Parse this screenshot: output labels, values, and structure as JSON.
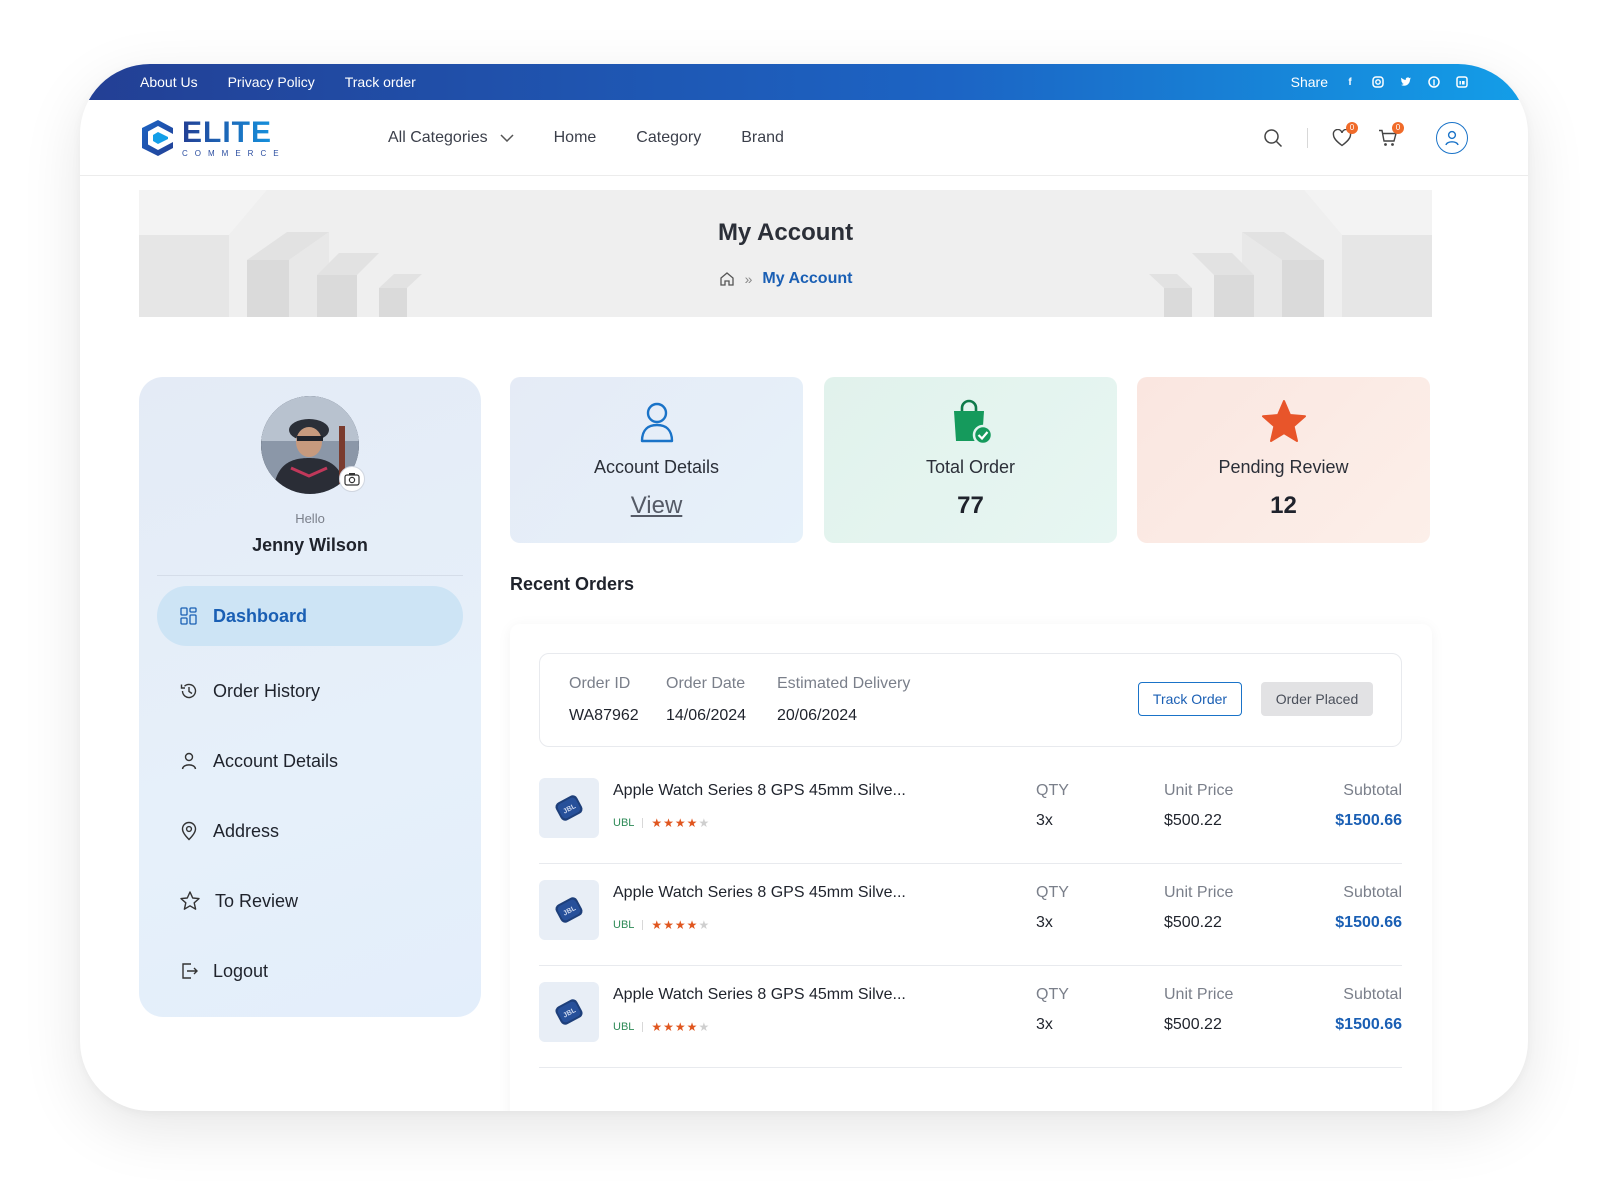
{
  "topbar": {
    "links": [
      "About Us",
      "Privacy Policy",
      "Track order"
    ],
    "share_label": "Share",
    "social_icons": [
      "facebook-icon",
      "instagram-icon",
      "twitter-icon",
      "pinterest-icon",
      "linkedin-icon"
    ]
  },
  "header": {
    "logo_main": "ELITE",
    "logo_sub": "COMMERCE",
    "nav": {
      "all_categories": "All Categories",
      "home": "Home",
      "category": "Category",
      "brand": "Brand"
    },
    "wishlist_count": "0",
    "cart_count": "0"
  },
  "hero": {
    "title": "My Account",
    "breadcrumb_current": "My Account"
  },
  "profile": {
    "greeting": "Hello",
    "name": "Jenny Wilson"
  },
  "menu": {
    "items": [
      {
        "label": "Dashboard",
        "icon": "dashboard-icon"
      },
      {
        "label": "Order History",
        "icon": "history-icon"
      },
      {
        "label": "Account Details",
        "icon": "user-icon"
      },
      {
        "label": "Address",
        "icon": "location-icon"
      },
      {
        "label": "To Review",
        "icon": "star-icon"
      },
      {
        "label": "Logout",
        "icon": "logout-icon"
      }
    ]
  },
  "cards": {
    "account": {
      "label": "Account Details",
      "value": "View"
    },
    "orders": {
      "label": "Total Order",
      "value": "77"
    },
    "review": {
      "label": "Pending Review",
      "value": "12"
    }
  },
  "recent": {
    "title": "Recent Orders",
    "order": {
      "id_label": "Order ID",
      "id": "WA87962",
      "date_label": "Order Date",
      "date": "14/06/2024",
      "delivery_label": "Estimated Delivery",
      "delivery": "20/06/2024",
      "track_button": "Track Order",
      "status": "Order Placed"
    },
    "items": [
      {
        "name": "Apple Watch Series 8 GPS 45mm Silve...",
        "brand": "UBL",
        "rating": 4,
        "qty_label": "QTY",
        "qty": "3x",
        "price_label": "Unit Price",
        "price": "$500.22",
        "subtotal_label": "Subtotal",
        "subtotal": "$1500.66"
      },
      {
        "name": "Apple Watch Series 8 GPS 45mm Silve...",
        "brand": "UBL",
        "rating": 4,
        "qty_label": "QTY",
        "qty": "3x",
        "price_label": "Unit Price",
        "price": "$500.22",
        "subtotal_label": "Subtotal",
        "subtotal": "$1500.66"
      },
      {
        "name": "Apple Watch Series 8 GPS 45mm Silve...",
        "brand": "UBL",
        "rating": 4,
        "qty_label": "QTY",
        "qty": "3x",
        "price_label": "Unit Price",
        "price": "$500.22",
        "subtotal_label": "Subtotal",
        "subtotal": "$1500.66"
      }
    ]
  },
  "colors": {
    "brand_blue": "#1a5fb4",
    "accent_orange": "#e0561f",
    "card_account_bg": "#e6eef8",
    "card_order_bg": "#e3f4ef",
    "card_review_bg": "#fbe9e4"
  }
}
